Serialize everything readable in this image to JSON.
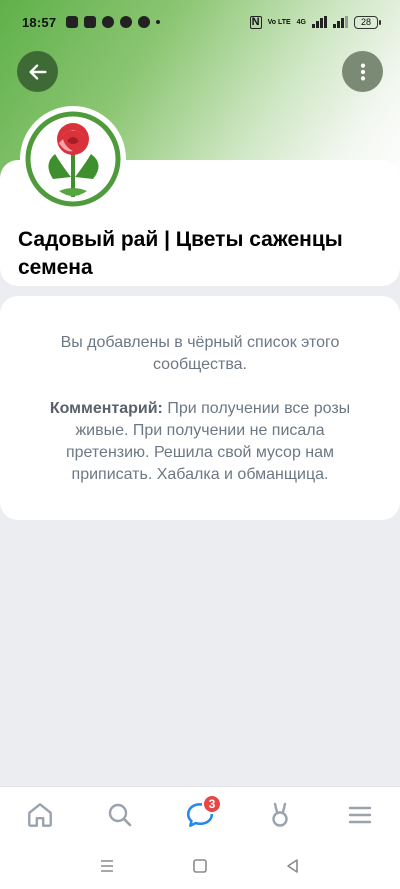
{
  "status_bar": {
    "time": "18:57",
    "network": "4G",
    "volte": "Vo LTE",
    "battery": "28"
  },
  "header": {
    "back_icon": "arrow-left-icon",
    "menu_icon": "more-vertical-icon",
    "accent_color": "#5fb04a"
  },
  "group": {
    "title": "Садовый рай | Цветы  саженцы семена"
  },
  "message": {
    "main_text": "Вы добавлены в чёрный список этого сообщества.",
    "comment_label": "Комментарий:",
    "comment_text": "При получении все розы живые. При получении не писала претензию. Решила свой мусор нам приписать. Хабалка и обманщица."
  },
  "tabbar": {
    "items": [
      {
        "name": "home",
        "icon": "home-icon"
      },
      {
        "name": "search",
        "icon": "search-icon"
      },
      {
        "name": "messages",
        "icon": "chat-icon",
        "badge": "3"
      },
      {
        "name": "clips",
        "icon": "clips-icon"
      },
      {
        "name": "menu",
        "icon": "hamburger-icon"
      }
    ],
    "active_color": "#2688eb",
    "inactive_color": "#99a2ad"
  }
}
